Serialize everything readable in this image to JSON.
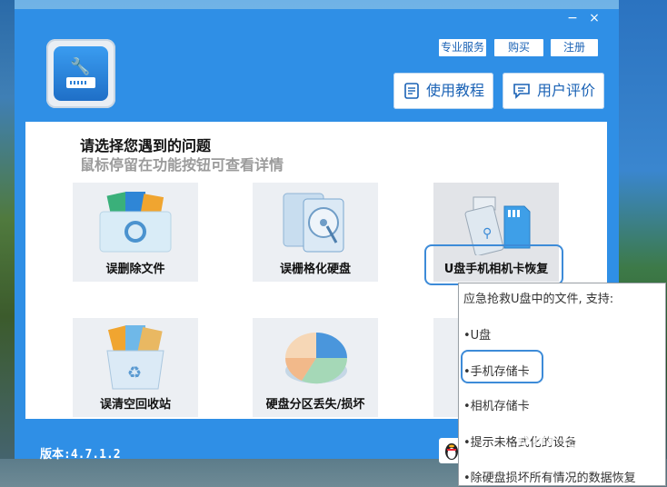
{
  "window": {
    "minimize_label": "−",
    "close_label": "×"
  },
  "top_links": {
    "service": "专业服务",
    "buy": "购买",
    "register": "注册"
  },
  "big_buttons": {
    "tutorial": "使用教程",
    "review": "用户评价"
  },
  "prompt": {
    "title": "请选择您遇到的问题",
    "subtitle": "鼠标停留在功能按钮可查看详情"
  },
  "tiles": [
    {
      "label": "误删除文件",
      "icon": "folder-files-icon"
    },
    {
      "label": "误栅格化硬盘",
      "icon": "hard-disk-icon"
    },
    {
      "label": "U盘手机相机卡恢复",
      "icon": "usb-sdcard-icon"
    },
    {
      "label": "误清空回收站",
      "icon": "recycle-bin-icon"
    },
    {
      "label": "硬盘分区丢失/损坏",
      "icon": "pie-partition-icon"
    }
  ],
  "tooltip": {
    "header": "应急抢救U盘中的文件, 支持:",
    "items": [
      "•U盘",
      "•手机存储卡",
      "•相机存储卡",
      "•提示未格式化的设备",
      "•除硬盘损坏所有情况的数据恢复"
    ]
  },
  "footer": {
    "version": "版本:4.7.1.2"
  },
  "watermark": "Bai 经验",
  "colors": {
    "window_blue": "#2f8fe6",
    "link_blue": "#1a62b5",
    "highlight": "#3d8bd8"
  }
}
